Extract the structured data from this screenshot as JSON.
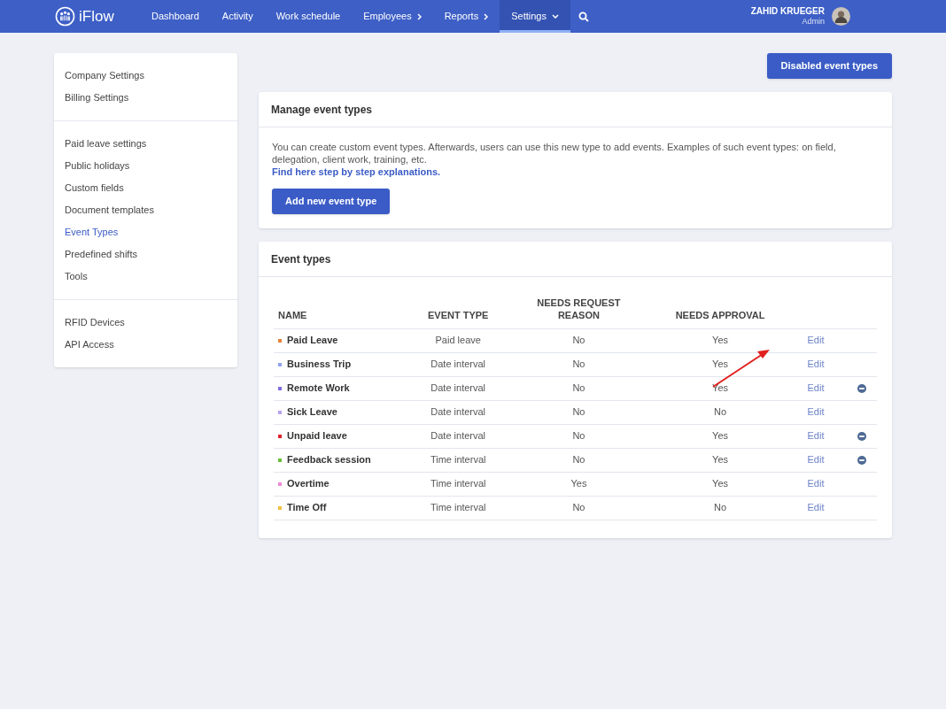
{
  "nav": {
    "logo": "iFlow",
    "items": [
      {
        "label": "Dashboard",
        "kind": "link",
        "selected": false
      },
      {
        "label": "Activity",
        "kind": "link",
        "selected": false
      },
      {
        "label": "Work schedule",
        "kind": "link",
        "selected": false
      },
      {
        "label": "Employees",
        "kind": "submenu",
        "selected": false
      },
      {
        "label": "Reports",
        "kind": "submenu",
        "selected": false
      },
      {
        "label": "Settings",
        "kind": "dropdown",
        "selected": true
      }
    ],
    "user": {
      "name": "ZAHID KRUEGER",
      "role": "Admin"
    }
  },
  "sidebar": {
    "groups": [
      [
        {
          "label": "Company Settings",
          "selected": false
        },
        {
          "label": "Billing Settings",
          "selected": false
        }
      ],
      [
        {
          "label": "Paid leave settings",
          "selected": false
        },
        {
          "label": "Public holidays",
          "selected": false
        },
        {
          "label": "Custom fields",
          "selected": false
        },
        {
          "label": "Document templates",
          "selected": false
        },
        {
          "label": "Event Types",
          "selected": true
        },
        {
          "label": "Predefined shifts",
          "selected": false
        },
        {
          "label": "Tools",
          "selected": false
        }
      ],
      [
        {
          "label": "RFID Devices",
          "selected": false
        },
        {
          "label": "API Access",
          "selected": false
        }
      ]
    ]
  },
  "disabled_button": "Disabled event types",
  "manage": {
    "title": "Manage event types",
    "text": "You can create custom event types. Afterwards, users can use this new type to add events. Examples of such event types: on field, delegation, client work, training, etc.",
    "link": "Find here step by step explanations.",
    "button": "Add new event type"
  },
  "event_types": {
    "title": "Event types",
    "columns": [
      "NAME",
      "EVENT TYPE",
      "NEEDS REQUEST REASON",
      "NEEDS APPROVAL"
    ],
    "rows": [
      {
        "name": "Paid Leave",
        "color": "#e8833a",
        "type": "Paid leave",
        "reason": "No",
        "approval": "Yes",
        "action": "Edit",
        "removable": false
      },
      {
        "name": "Business Trip",
        "color": "#8fa3ee",
        "type": "Date interval",
        "reason": "No",
        "approval": "Yes",
        "action": "Edit",
        "removable": false
      },
      {
        "name": "Remote Work",
        "color": "#7c6fe0",
        "type": "Date interval",
        "reason": "No",
        "approval": "Yes",
        "action": "Edit",
        "removable": true
      },
      {
        "name": "Sick Leave",
        "color": "#b7a2f2",
        "type": "Date interval",
        "reason": "No",
        "approval": "No",
        "action": "Edit",
        "removable": false
      },
      {
        "name": "Unpaid leave",
        "color": "#e0202a",
        "type": "Date interval",
        "reason": "No",
        "approval": "Yes",
        "action": "Edit",
        "removable": true
      },
      {
        "name": "Feedback session",
        "color": "#6abf3a",
        "type": "Time interval",
        "reason": "No",
        "approval": "Yes",
        "action": "Edit",
        "removable": true
      },
      {
        "name": "Overtime",
        "color": "#f08ad8",
        "type": "Time interval",
        "reason": "Yes",
        "approval": "Yes",
        "action": "Edit",
        "removable": false
      },
      {
        "name": "Time Off",
        "color": "#f2c040",
        "type": "Time interval",
        "reason": "No",
        "approval": "No",
        "action": "Edit",
        "removable": false
      }
    ]
  }
}
